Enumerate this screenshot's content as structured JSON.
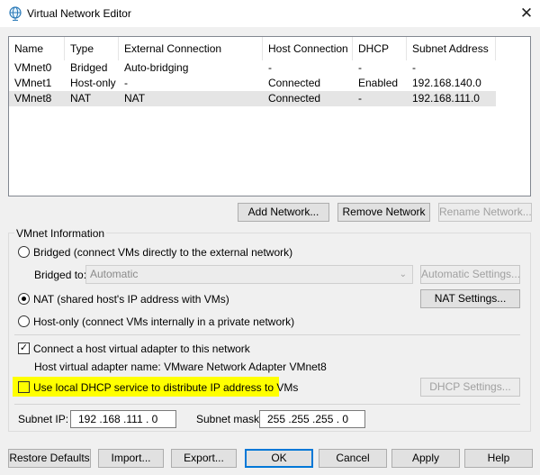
{
  "window": {
    "title": "Virtual Network Editor",
    "close_glyph": "✕",
    "icon": "network-globe-icon"
  },
  "table": {
    "headers": [
      "Name",
      "Type",
      "External Connection",
      "Host Connection",
      "DHCP",
      "Subnet Address"
    ],
    "rows": [
      [
        "VMnet0",
        "Bridged",
        "Auto-bridging",
        "-",
        "-",
        "-"
      ],
      [
        "VMnet1",
        "Host-only",
        "-",
        "Connected",
        "Enabled",
        "192.168.140.0"
      ],
      [
        "VMnet8",
        "NAT",
        "NAT",
        "Connected",
        "-",
        "192.168.111.0"
      ]
    ],
    "selected_row": 2
  },
  "list_buttons": {
    "add": "Add Network...",
    "remove": "Remove Network",
    "rename": "Rename Network..."
  },
  "vmnet_info": {
    "title": "VMnet Information",
    "bridged_label": "Bridged (connect VMs directly to the external network)",
    "bridged_to_label": "Bridged to:",
    "bridged_to_value": "Automatic",
    "automatic_settings": "Automatic Settings...",
    "nat_label": "NAT (shared host's IP address with VMs)",
    "nat_settings": "NAT Settings...",
    "hostonly_label": "Host-only (connect VMs internally in a private network)",
    "connect_adapter_label": "Connect a host virtual adapter to this network",
    "adapter_name_text": "Host virtual adapter name: VMware Network Adapter VMnet8",
    "dhcp_label": "Use local DHCP service to distribute IP address to VMs",
    "dhcp_settings": "DHCP Settings...",
    "subnet_ip_label": "Subnet IP:",
    "subnet_ip_value": "192 .168 .111 . 0",
    "subnet_mask_label": "Subnet mask:",
    "subnet_mask_value": "255 .255 .255 . 0",
    "selected_mode": "NAT",
    "connect_adapter_checked": true,
    "dhcp_checked": false,
    "highlight_color": "#ffff00"
  },
  "footer": {
    "restore": "Restore Defaults",
    "import": "Import...",
    "export": "Export...",
    "ok": "OK",
    "cancel": "Cancel",
    "apply": "Apply",
    "help": "Help"
  }
}
